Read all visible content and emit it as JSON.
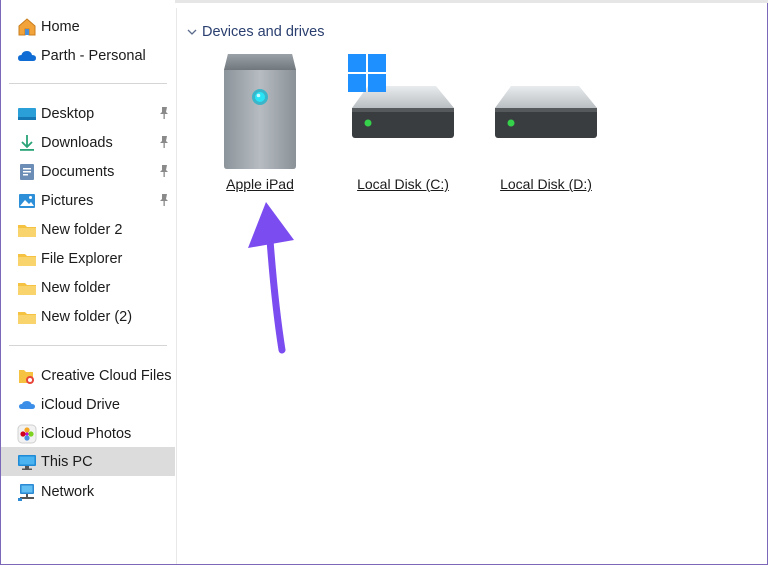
{
  "sidebar": {
    "top_items": [
      {
        "label": "Home",
        "icon": "home-icon"
      },
      {
        "label": "Parth - Personal",
        "icon": "onedrive-cloud-icon"
      }
    ],
    "quick_access": [
      {
        "label": "Desktop",
        "icon": "desktop-icon",
        "pinned": true
      },
      {
        "label": "Downloads",
        "icon": "download-icon",
        "pinned": true
      },
      {
        "label": "Documents",
        "icon": "documents-icon",
        "pinned": true
      },
      {
        "label": "Pictures",
        "icon": "pictures-icon",
        "pinned": true
      },
      {
        "label": "New folder 2",
        "icon": "folder-icon",
        "pinned": false
      },
      {
        "label": "File Explorer",
        "icon": "folder-icon",
        "pinned": false
      },
      {
        "label": "New folder",
        "icon": "folder-icon",
        "pinned": false
      },
      {
        "label": "New folder (2)",
        "icon": "folder-icon",
        "pinned": false
      }
    ],
    "locations": [
      {
        "label": "Creative Cloud Files",
        "icon": "creative-cloud-icon"
      },
      {
        "label": "iCloud Drive",
        "icon": "icloud-drive-icon"
      },
      {
        "label": "iCloud Photos",
        "icon": "icloud-photos-icon"
      },
      {
        "label": "This PC",
        "icon": "this-pc-icon",
        "selected": true
      },
      {
        "label": "Network",
        "icon": "network-icon"
      }
    ]
  },
  "main": {
    "group_title": "Devices and drives",
    "drives": [
      {
        "label": "Apple iPad",
        "icon": "apple-ipad-device-icon"
      },
      {
        "label": "Local Disk (C:)",
        "icon": "windows-drive-icon"
      },
      {
        "label": "Local Disk (D:)",
        "icon": "hard-drive-icon"
      }
    ]
  },
  "colors": {
    "accent": "#7b4cf0",
    "selected_bg": "#dcdcdc",
    "group_header": "#2a3f6f",
    "drive_led": "#35d14a"
  }
}
